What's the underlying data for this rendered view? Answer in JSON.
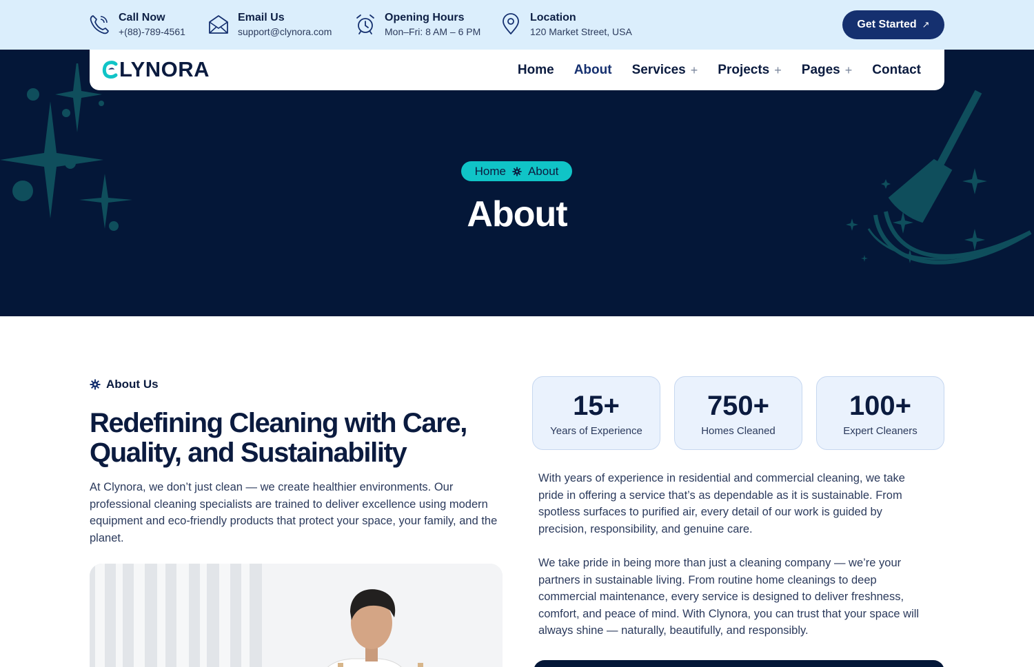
{
  "topbar": {
    "contacts": [
      {
        "title": "Call Now",
        "value": "+(88)-789-4561",
        "icon": "phone-icon"
      },
      {
        "title": "Email Us",
        "value": "support@clynora.com",
        "icon": "envelope-icon"
      },
      {
        "title": "Opening Hours",
        "value": "Mon–Fri: 8 AM – 6 PM",
        "icon": "alarm-clock-icon"
      },
      {
        "title": "Location",
        "value": "120 Market Street, USA",
        "icon": "map-pin-icon"
      }
    ],
    "cta_label": "Get Started",
    "cta_icon": "arrow-up-right-icon"
  },
  "brand": {
    "name": "LYNORA",
    "logo_letter": "C"
  },
  "nav": {
    "items": [
      {
        "label": "Home"
      },
      {
        "label": "About"
      },
      {
        "label": "Services",
        "has_children": true
      },
      {
        "label": "Projects",
        "has_children": true
      },
      {
        "label": "Pages",
        "has_children": true
      },
      {
        "label": "Contact"
      }
    ]
  },
  "hero": {
    "breadcrumb": {
      "home": "Home",
      "current": "About"
    },
    "title": "About"
  },
  "about": {
    "tagline": "About Us",
    "heading_line1": "Redefining Cleaning with Care,",
    "heading_line2": "Quality, and Sustainability",
    "intro": "At Clynora, we don’t just clean — we create healthier environments. Our professional cleaning specialists are trained to deliver excellence using modern equipment and eco-friendly products that protect your space, your family, and the planet.",
    "stats": [
      {
        "value": "15+",
        "label": "Years of Experience"
      },
      {
        "value": "750+",
        "label": "Homes Cleaned"
      },
      {
        "value": "100+",
        "label": "Expert Cleaners"
      }
    ],
    "paragraph1": "With years of experience in residential and commercial cleaning, we take pride in offering a service that’s as dependable as it is sustainable. From spotless surfaces to purified air, every detail of our work is guided by precision, responsibility, and genuine care.",
    "paragraph2": "We take pride in being more than just a cleaning company — we’re your partners in sustainable living. From routine home cleanings to deep commercial maintenance, every service is designed to deliver freshness, comfort, and peace of mind. With Clynora, you can trust that your space will always shine — naturally, beautifully, and responsibly."
  },
  "colors": {
    "navy": "#041738",
    "accent": "#10c4c7",
    "button": "#15306f",
    "topbar": "#dbeefc",
    "card": "#eaf2fd"
  }
}
